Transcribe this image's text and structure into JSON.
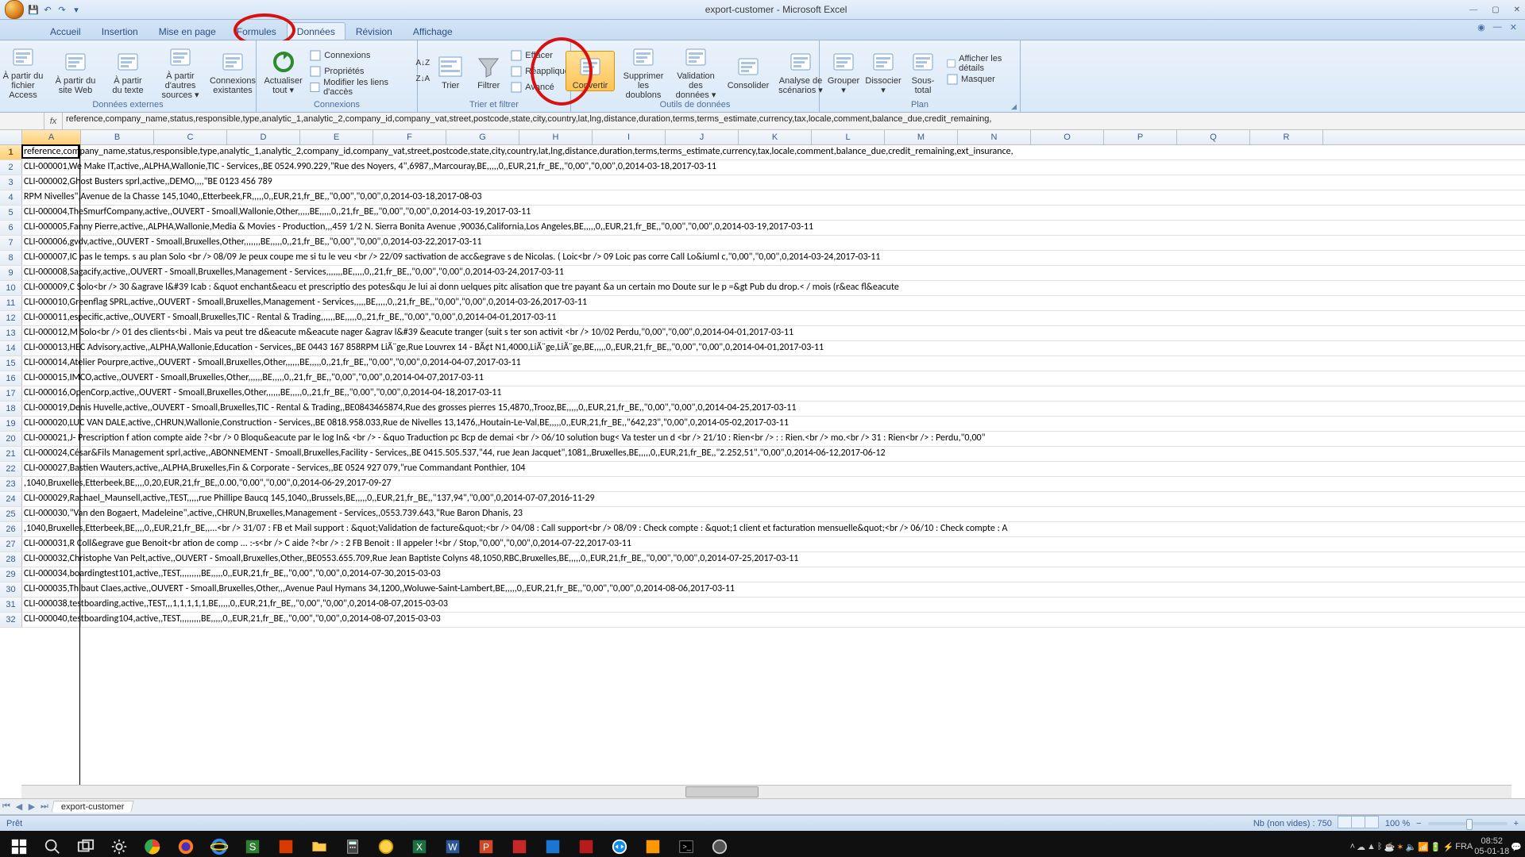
{
  "title": "export-customer - Microsoft Excel",
  "qat": {
    "save": "💾",
    "undo": "↶",
    "redo": "↷"
  },
  "tabs": [
    "Accueil",
    "Insertion",
    "Mise en page",
    "Formules",
    "Données",
    "Révision",
    "Affichage"
  ],
  "active_tab_index": 4,
  "ribbon": {
    "groups": {
      "ext_data": {
        "name": "Données externes",
        "btns": [
          {
            "id": "from-access",
            "label": "À partir du\nfichier Access"
          },
          {
            "id": "from-web",
            "label": "À partir du\nsite Web"
          },
          {
            "id": "from-text",
            "label": "À partir\ndu texte"
          },
          {
            "id": "from-other",
            "label": "À partir d'autres\nsources ▾"
          },
          {
            "id": "existing-conn",
            "label": "Connexions\nexistantes"
          }
        ]
      },
      "connections": {
        "name": "Connexions",
        "refresh": {
          "id": "refresh-all",
          "label": "Actualiser\ntout ▾"
        },
        "items": [
          {
            "id": "connections",
            "label": "Connexions"
          },
          {
            "id": "properties",
            "label": "Propriétés"
          },
          {
            "id": "edit-links",
            "label": "Modifier les liens d'accès"
          }
        ]
      },
      "sort_filter": {
        "name": "Trier et filtrer",
        "sort_az": "A↓Z",
        "sort_za": "Z↓A",
        "sort_btn": {
          "id": "sort",
          "label": "Trier"
        },
        "filter_btn": {
          "id": "filter",
          "label": "Filtrer"
        },
        "items": [
          {
            "id": "clear",
            "label": "Effacer"
          },
          {
            "id": "reapply",
            "label": "Réappliquer"
          },
          {
            "id": "advanced",
            "label": "Avancé"
          }
        ]
      },
      "data_tools": {
        "name": "Outils de données",
        "btns": [
          {
            "id": "text-to-columns",
            "label": "Convertir"
          },
          {
            "id": "remove-dup",
            "label": "Supprimer\nles doublons"
          },
          {
            "id": "data-validation",
            "label": "Validation des\ndonnées ▾"
          },
          {
            "id": "consolidate",
            "label": "Consolider"
          },
          {
            "id": "whatif",
            "label": "Analyse de\nscénarios ▾"
          }
        ]
      },
      "outline": {
        "name": "Plan",
        "btns": [
          {
            "id": "group",
            "label": "Grouper\n▾"
          },
          {
            "id": "ungroup",
            "label": "Dissocier\n▾"
          },
          {
            "id": "subtotal",
            "label": "Sous-total"
          }
        ],
        "items": [
          {
            "id": "show-detail",
            "label": "Afficher les détails"
          },
          {
            "id": "hide-detail",
            "label": "Masquer"
          }
        ]
      }
    }
  },
  "namebox": "",
  "fx_label": "fx",
  "formula": "reference,company_name,status,responsible,type,analytic_1,analytic_2,company_id,company_vat,street,postcode,state,city,country,lat,lng,distance,duration,terms,terms_estimate,currency,tax,locale,comment,balance_due,credit_remaining,",
  "columns": [
    "A",
    "B",
    "C",
    "D",
    "E",
    "F",
    "G",
    "H",
    "I",
    "J",
    "K",
    "L",
    "M",
    "N",
    "O",
    "P",
    "Q",
    "R"
  ],
  "rows": [
    "reference,company_name,status,responsible,type,analytic_1,analytic_2,company_id,company_vat,street,postcode,state,city,country,lat,lng,distance,duration,terms,terms_estimate,currency,tax,locale,comment,balance_due,credit_remaining,ext_insurance,",
    "CLI-000001,We Make IT,active,,ALPHA,Wallonie,TIC - Services,,BE 0524.990.229,\"Rue des Noyers, 4\",6987,,Marcouray,BE,,,,,0,,EUR,21,fr_BE,,\"0,00\",\"0,00\",0,2014-03-18,2017-03-11",
    "CLI-000002,Ghost Busters sprl,active,,DEMO,,,,\"BE 0123 456 789",
    "RPM Nivelles\",Avenue de la Chasse 145,1040,,Etterbeek,FR,,,,,0,,EUR,21,fr_BE,,\"0,00\",\"0,00\",0,2014-03-18,2017-08-03",
    "CLI-000004,TheSmurfCompany,active,,OUVERT - Smoall,Wallonie,Other,,,,,BE,,,,,0,,21,fr_BE,,\"0,00\",\"0,00\",0,2014-03-19,2017-03-11",
    "CLI-000005,Fanny Pierre,active,,ALPHA,Wallonie,Media & Movies - Production,,,459 1/2 N. Sierra Bonita Avenue ,90036,California,Los Angeles,BE,,,,,0,,EUR,21,fr_BE,,\"0,00\",\"0,00\",0,2014-03-19,2017-03-11",
    "CLI-000006,gvdv,active,,OUVERT - Smoall,Bruxelles,Other,,,,,,,BE,,,,,0,,21,fr_BE,,\"0,00\",\"0,00\",0,2014-03-22,2017-03-11",
    "CLI-000007,IC   pas le temps. s au plan Solo <br />  08/09   Je peux coupe me si tu le veu <br />  22/09   sactivation de acc&egrave   s de Nicolas. (   Loic<br />  09   Loic pas corre  Call Lo&iuml  c,\"0,00\",\"0,00\",0,2014-03-24,2017-03-11",
    "CLI-000008,Sagacify,active,,OUVERT - Smoall,Bruxelles,Management - Services,,,,,,,BE,,,,,0,,21,fr_BE,,\"0,00\",\"0,00\",0,2014-03-24,2017-03-11",
    "CLI-000009,C   Solo<br />  30 &agrave          l&#39            Icab : &quot   enchant&eacu  et prescriptio des potes&qu  Je lui ai donn  uelques pitc  alisation que   tre payant &a   un certain mo Doute sur le p  =&gt                                         Pub du drop.< / mois (r&eac fl&eacute",
    "CLI-000010,Greenflag SPRL,active,,OUVERT - Smoall,Bruxelles,Management - Services,,,,,BE,,,,,0,,21,fr_BE,,\"0,00\",\"0,00\",0,2014-03-26,2017-03-11",
    "CLI-000011,especific,active,,OUVERT - Smoall,Bruxelles,TIC - Rental & Trading,,,,,,BE,,,,,0,,21,fr_BE,,\"0,00\",\"0,00\",0,2014-04-01,2017-03-11",
    "CLI-000012,M   Solo<br />  01 des clients<bi . Mais va peut tre d&eacute  m&eacute      nager &agrav  l&#39           &eacute           tranger (suit s ter son activit <br />  10/02   Perdu,\"0,00\",\"0,00\",0,2014-04-01,2017-03-11",
    "CLI-000013,HEC Advisory,active,,ALPHA,Wallonie,Education - Services,,BE 0443 167 858RPM LiÃ¨ge,Rue Louvrex 14 - BÃ¢t N1,4000,LiÃ¨ge,LiÃ¨ge,BE,,,,,0,,EUR,21,fr_BE,,\"0,00\",\"0,00\",0,2014-04-01,2017-03-11",
    "CLI-000014,Atelier Pourpre,active,,OUVERT - Smoall,Bruxelles,Other,,,,,,BE,,,,,0,,21,fr_BE,,\"0,00\",\"0,00\",0,2014-04-07,2017-03-11",
    "CLI-000015,IMCO,active,,OUVERT - Smoall,Bruxelles,Other,,,,,,BE,,,,,0,,21,fr_BE,,\"0,00\",\"0,00\",0,2014-04-07,2017-03-11",
    "CLI-000016,OpenCorp,active,,OUVERT - Smoall,Bruxelles,Other,,,,,,BE,,,,,0,,21,fr_BE,,\"0,00\",\"0,00\",0,2014-04-18,2017-03-11",
    "CLI-000019,Denis Huvelle,active,,OUVERT - Smoall,Bruxelles,TIC - Rental & Trading,,BE0843465874,Rue des grosses pierres 15,4870,,Trooz,BE,,,,,0,,EUR,21,fr_BE,,\"0,00\",\"0,00\",0,2014-04-25,2017-03-11",
    "CLI-000020,LUC VAN DALE,active,,CHRUN,Wallonie,Construction - Services,,BE 0818.958.033,Rue de Nivelles 13,1476,,Houtain-Le-Val,BE,,,,,0,,EUR,21,fr_BE,,\"642,23\",\"0,00\",0,2014-05-02,2017-03-11",
    "CLI-000021,J-   Prescription f ation compte  aide ?<br />  0 Bloqu&eacute  par le log In& <br />  - &quo Traduction pc  Bcp de demai <br />  06/10  solution bug< Va tester un d <br />  21/10   : Rien<br />  :  : Rien.<br />  mo.<br />  31  : Rien<br />  :  Perdu,\"0,00\"",
    "CLI-000024,César&Fils Management sprl,active,,ABONNEMENT - Smoall,Bruxelles,Facility - Services,,BE 0415.505.537,\"44, rue Jean Jacquet\",1081,,Bruxelles,BE,,,,,0,,EUR,21,fr_BE,,\"2.252,51\",\"0,00\",0,2014-06-12,2017-06-12",
    "CLI-000027,Bastien Wauters,active,,ALPHA,Bruxelles,Fin & Corporate - Services,,BE 0524 927 079,\"rue Commandant Ponthier, 104",
    ",1040,Bruxelles,Etterbeek,BE,,,,0,20,EUR,21,fr_BE,,0.00,\"0,00\",\"0,00\",0,2014-06-29,2017-09-27",
    "CLI-000029,Rachael_Maunsell,active,,TEST,,,,,rue Phillipe Baucq 145,1040,,Brussels,BE,,,,,0,,EUR,21,fr_BE,,\"137,94\",\"0,00\",0,2014-07-07,2016-11-29",
    "CLI-000030,\"Van den Bogaert, Madeleine\",active,,CHRUN,Bruxelles,Management - Services,,0553.739.643,\"Rue Baron Dhanis, 23",
    ",1040,Bruxelles,Etterbeek,BE,,,,0,,EUR,21,fr_BE,,...<br />  31/07 : FB et Mail support : &quot;Validation de facture&quot;<br />  04/08 : Call support<br />  08/09 : Check compte : &quot;1 client et facturation mensuelle&quot;<br />  06/10 : Check compte : A",
    "CLI-000031,R   Coll&egrave   gue Benoit<br ation de comp  ... :-s<br />  C aide ?<br />  : 2 FB Benoit : Il  appeler !<br /  Stop,\"0,00\",\"0,00\",0,2014-07-22,2017-03-11",
    "CLI-000032,Christophe Van Pelt,active,,OUVERT - Smoall,Bruxelles,Other,,BE0553.655.709,Rue Jean Baptiste Colyns 48,1050,RBC,Bruxelles,BE,,,,,0,,EUR,21,fr_BE,,\"0,00\",\"0,00\",0,2014-07-25,2017-03-11",
    "CLI-000034,boardingtest101,active,,TEST,,,,,,,,,BE,,,,,0,,EUR,21,fr_BE,,\"0,00\",\"0,00\",0,2014-07-30,2015-03-03",
    "CLI-000035,Thibaut Claes,active,,OUVERT - Smoall,Bruxelles,Other,,,Avenue Paul Hymans 34,1200,,Woluwe-Saint-Lambert,BE,,,,,0,,EUR,21,fr_BE,,\"0,00\",\"0,00\",0,2014-08-06,2017-03-11",
    "CLI-000038,testboarding,active,,TEST,,,1,1,1,1,1,BE,,,,,0,,EUR,21,fr_BE,,\"0,00\",\"0,00\",0,2014-08-07,2015-03-03",
    "CLI-000040,testboarding104,active,,TEST,,,,,,,,,BE,,,,,0,,EUR,21,fr_BE,,\"0,00\",\"0,00\",0,2014-08-07,2015-03-03"
  ],
  "sheet_tab": "export-customer",
  "status_left": "Prêt",
  "status_count": "Nb (non vides) : 750",
  "zoom": "100 %",
  "tray": {
    "lang": "FRA",
    "time": "08:52",
    "date": "05-01-18"
  }
}
